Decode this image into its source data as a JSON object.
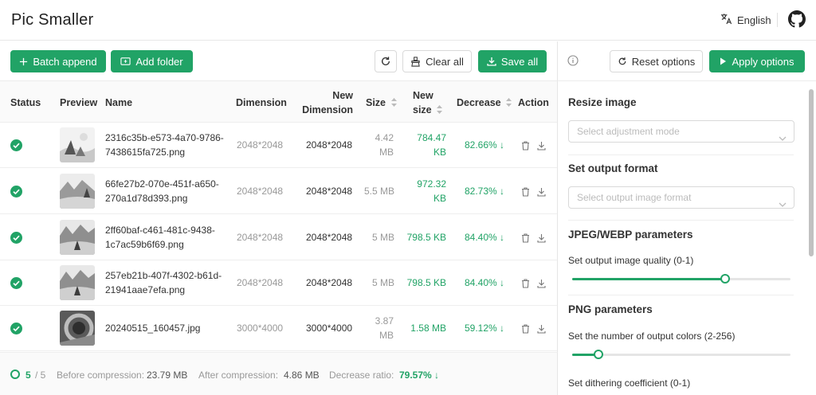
{
  "app": {
    "title": "Pic Smaller"
  },
  "header": {
    "language": "English",
    "language_icon": "translate-icon",
    "github_icon": "github-icon"
  },
  "toolbar": {
    "batch_append": "Batch append",
    "add_folder": "Add folder",
    "clear_all": "Clear all",
    "save_all": "Save all"
  },
  "table": {
    "columns": {
      "status": "Status",
      "preview": "Preview",
      "name": "Name",
      "dimension": "Dimension",
      "new_dimension": "New Dimension",
      "size": "Size",
      "new_size": "New size",
      "decrease": "Decrease",
      "action": "Action"
    },
    "rows": [
      {
        "status": "done",
        "name": "2316c35b-e573-4a70-9786-7438615fa725.png",
        "dimension": "2048*2048",
        "new_dimension": "2048*2048",
        "size": "4.42 MB",
        "new_size": "784.47 KB",
        "decrease": "82.66%"
      },
      {
        "status": "done",
        "name": "66fe27b2-070e-451f-a650-270a1d78d393.png",
        "dimension": "2048*2048",
        "new_dimension": "2048*2048",
        "size": "5.5 MB",
        "new_size": "972.32 KB",
        "decrease": "82.73%"
      },
      {
        "status": "done",
        "name": "2ff60baf-c461-481c-9438-1c7ac59b6f69.png",
        "dimension": "2048*2048",
        "new_dimension": "2048*2048",
        "size": "5 MB",
        "new_size": "798.5 KB",
        "decrease": "84.40%"
      },
      {
        "status": "done",
        "name": "257eb21b-407f-4302-b61d-21941aae7efa.png",
        "dimension": "2048*2048",
        "new_dimension": "2048*2048",
        "size": "5 MB",
        "new_size": "798.5 KB",
        "decrease": "84.40%"
      },
      {
        "status": "done",
        "name": "20240515_160457.jpg",
        "dimension": "3000*4000",
        "new_dimension": "3000*4000",
        "size": "3.87 MB",
        "new_size": "1.58 MB",
        "decrease": "59.12%"
      }
    ]
  },
  "footer": {
    "done": "5",
    "total": "/ 5",
    "before_label": "Before compression:",
    "before_value": "23.79 MB",
    "after_label": "After compression:",
    "after_value": "4.86 MB",
    "ratio_label": "Decrease ratio:",
    "ratio_value": "79.57%"
  },
  "panel": {
    "reset": "Reset options",
    "apply": "Apply options",
    "resize_title": "Resize image",
    "resize_placeholder": "Select adjustment mode",
    "format_title": "Set output format",
    "format_placeholder": "Select output image format",
    "jpeg_title": "JPEG/WEBP parameters",
    "quality_label": "Set output image quality (0-1)",
    "quality_fraction": 0.7,
    "png_title": "PNG parameters",
    "colors_label": "Set the number of output colors (2-256)",
    "colors_fraction": 0.12,
    "dither_label": "Set dithering coefficient (0-1)"
  },
  "colors": {
    "accent": "#21a366",
    "muted": "#999999",
    "border": "#d9d9d9"
  }
}
